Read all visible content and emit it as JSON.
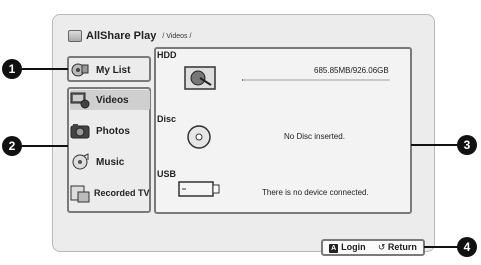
{
  "header": {
    "app_name": "AllShare Play",
    "breadcrumb": "/ Videos /"
  },
  "sidebar": {
    "items": [
      {
        "label": "My List",
        "icon": "mylist-icon"
      },
      {
        "label": "Videos",
        "icon": "videos-icon",
        "selected": true
      },
      {
        "label": "Photos",
        "icon": "photos-icon"
      },
      {
        "label": "Music",
        "icon": "music-icon"
      },
      {
        "label": "Recorded TV",
        "icon": "recorded-tv-icon"
      }
    ]
  },
  "devices": {
    "hdd": {
      "label": "HDD",
      "usage": "685.85MB/926.06GB",
      "usage_fraction": 0.0007
    },
    "disc": {
      "label": "Disc",
      "status": "No Disc inserted."
    },
    "usb": {
      "label": "USB",
      "status": "There is no device connected."
    }
  },
  "bottom_bar": {
    "key": "A",
    "login_label": "Login",
    "return_label": "Return"
  },
  "callouts": [
    "1",
    "2",
    "3",
    "4"
  ],
  "colors": {
    "panel_bg": "#ececec",
    "border": "#7a7a7a",
    "highlight": "#cfcfcf",
    "callout": "#111111"
  }
}
